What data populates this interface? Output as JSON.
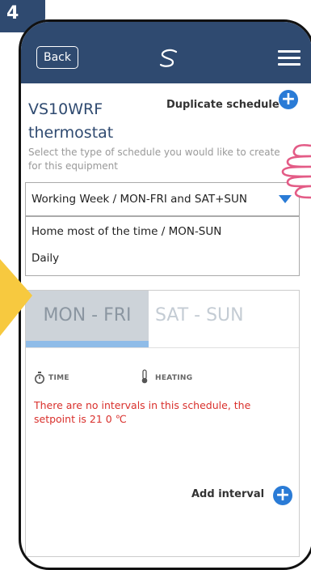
{
  "step": "4",
  "header": {
    "back_label": "Back",
    "logo_icon": "salus-logo-icon",
    "menu_icon": "hamburger-menu-icon"
  },
  "page": {
    "title": "VS10WRF thermostat",
    "duplicate_label": "Duplicate schedule",
    "subtitle": "Select the type of schedule you would like to create for this equipment"
  },
  "schedule_type": {
    "selected": "Working Week / MON-FRI and SAT+SUN",
    "options": [
      "Home most of the time / MON-SUN",
      "Daily"
    ]
  },
  "tabs": [
    {
      "label": "MON - FRI",
      "active": true
    },
    {
      "label": "SAT - SUN",
      "active": false
    }
  ],
  "columns": {
    "time": "TIME",
    "heating": "HEATING"
  },
  "message": "There are no intervals in this schedule, the setpoint is 21 0 ℃",
  "add_interval_label": "Add interval",
  "colors": {
    "header": "#2f4a70",
    "accent": "#2a7bd6",
    "warning": "#d9302c",
    "pointer": "#f7c93f",
    "hand": "#e35b86"
  }
}
